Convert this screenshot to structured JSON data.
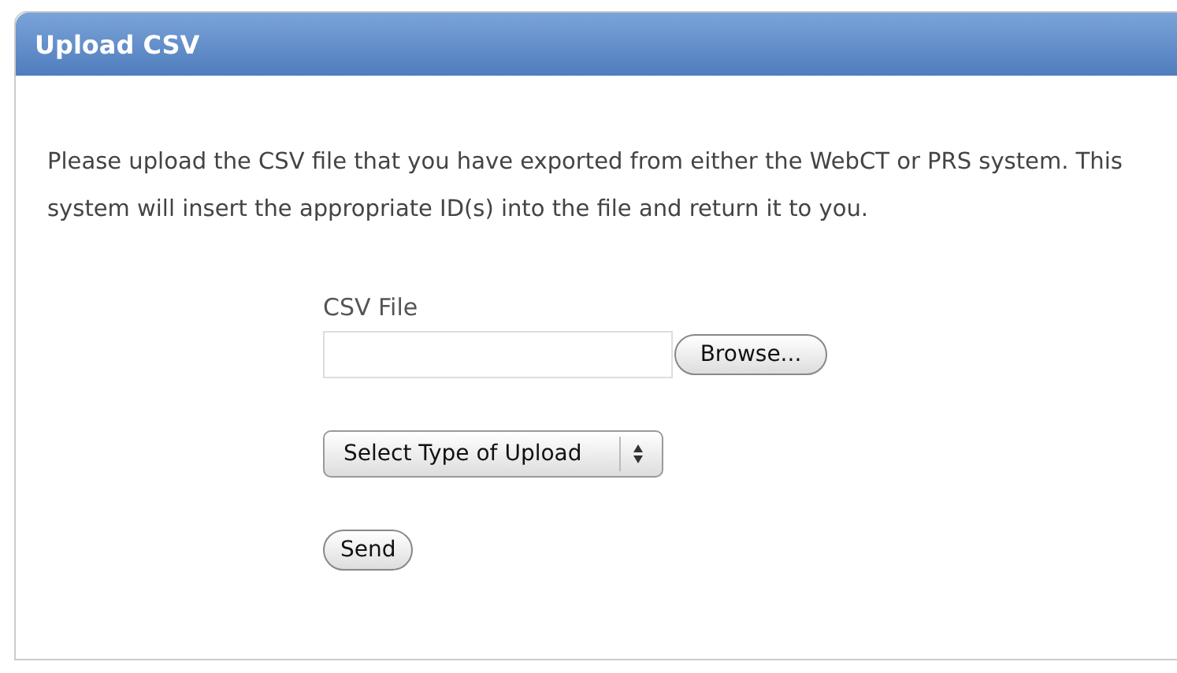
{
  "panel": {
    "title": "Upload CSV"
  },
  "intro": "Please upload the CSV file that you have exported from either the WebCT or PRS system. This system will insert the appropriate ID(s) into the file and return it to you.",
  "form": {
    "file_label": "CSV File",
    "browse_button": "Browse...",
    "type_select": "Select Type of Upload",
    "send_button": "Send"
  }
}
